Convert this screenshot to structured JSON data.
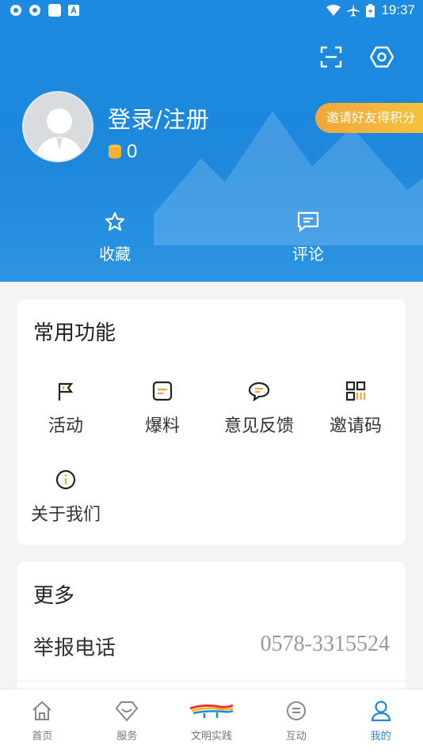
{
  "status_bar": {
    "time": "19:37"
  },
  "header": {
    "login_label": "登录/注册",
    "coins": "0",
    "invite_badge": "邀请好友得积分",
    "quick_actions": [
      {
        "label": "收藏",
        "icon": "star-icon"
      },
      {
        "label": "评论",
        "icon": "comment-icon"
      }
    ],
    "top_icons": [
      "scan-icon",
      "settings-icon"
    ]
  },
  "common_functions": {
    "title": "常用功能",
    "items": [
      {
        "label": "活动",
        "icon": "flag-icon"
      },
      {
        "label": "爆料",
        "icon": "note-icon"
      },
      {
        "label": "意见反馈",
        "icon": "feedback-icon"
      },
      {
        "label": "邀请码",
        "icon": "qrcode-icon"
      },
      {
        "label": "关于我们",
        "icon": "info-icon"
      }
    ]
  },
  "more": {
    "title": "更多",
    "rows": [
      {
        "label": "举报电话",
        "value": "0578-3315524"
      }
    ]
  },
  "tabbar": {
    "items": [
      {
        "label": "首页",
        "icon": "home-icon",
        "active": false
      },
      {
        "label": "服务",
        "icon": "service-icon",
        "active": false
      },
      {
        "label": "文明实践",
        "icon": "civilization-logo-icon",
        "active": false
      },
      {
        "label": "互动",
        "icon": "interaction-icon",
        "active": false
      },
      {
        "label": "我的",
        "icon": "profile-icon",
        "active": true
      }
    ]
  },
  "colors": {
    "primary": "#1b8ae0",
    "badge": "#f2ad3b",
    "background": "#f3f4f6"
  }
}
